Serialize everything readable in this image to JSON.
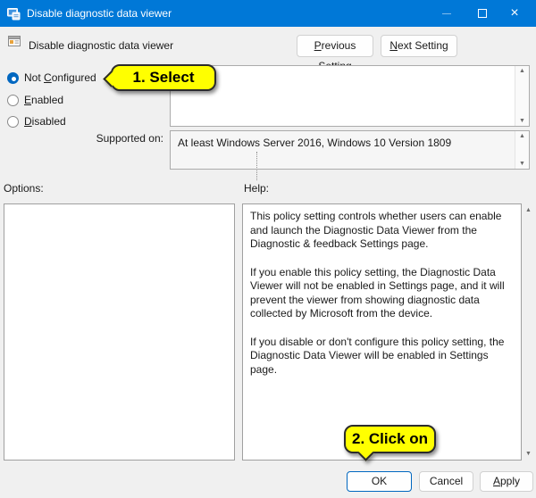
{
  "titlebar": {
    "title": "Disable diagnostic data viewer"
  },
  "header": {
    "setting_title": "Disable diagnostic data viewer",
    "previous_setting": {
      "key": "P",
      "post": "revious Setting"
    },
    "next_setting": {
      "key": "N",
      "post": "ext Setting"
    }
  },
  "radios": {
    "not_configured": {
      "pre": "Not ",
      "key": "C",
      "post": "onfigured",
      "selected": true
    },
    "enabled": {
      "pre": "",
      "key": "E",
      "post": "nabled",
      "selected": false
    },
    "disabled": {
      "pre": "",
      "key": "D",
      "post": "isabled",
      "selected": false
    }
  },
  "supported": {
    "label": "Supported on:",
    "value": "At least Windows Server 2016, Windows 10 Version 1809"
  },
  "options": {
    "label": "Options:"
  },
  "help": {
    "label": "Help:",
    "paragraphs": [
      "This policy setting controls whether users can enable and launch the Diagnostic Data Viewer from the Diagnostic & feedback Settings page.",
      "If you enable this policy setting, the Diagnostic Data Viewer will not be enabled in Settings page, and it will prevent the viewer from showing diagnostic data collected by Microsoft from the device.",
      "If you disable or don't configure this policy setting, the Diagnostic Data Viewer will be enabled in Settings page."
    ]
  },
  "callouts": {
    "select": "1. Select",
    "click": "2. Click on"
  },
  "footer": {
    "ok": "OK",
    "cancel": "Cancel",
    "apply": {
      "key": "A",
      "post": "pply"
    }
  },
  "icons": {
    "scroll_up": "▲",
    "scroll_down": "▼",
    "close": "×"
  },
  "colors": {
    "titlebar": "#0078d7",
    "accent": "#0067c0",
    "callout": "#ffff00",
    "dialog_bg": "#f0f0f0"
  }
}
